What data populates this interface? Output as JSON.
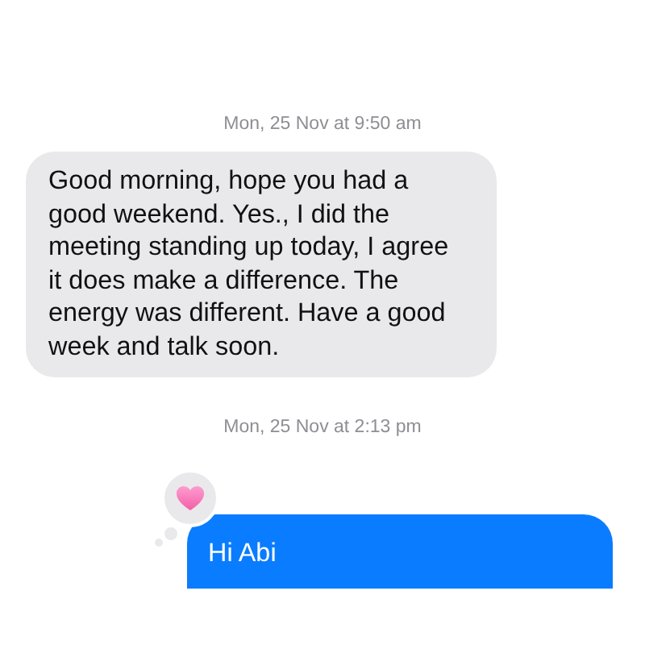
{
  "messages": [
    {
      "kind": "timestamp",
      "text": "Mon, 25 Nov at 9:50 am"
    },
    {
      "kind": "received",
      "text": "Good morning, hope you had a good weekend. Yes., I did the meeting standing up today, I agree it does make a difference. The energy was different. Have a good week and talk soon."
    },
    {
      "kind": "timestamp",
      "text": "Mon, 25 Nov at 2:13 pm"
    },
    {
      "kind": "sent",
      "text": "Hi Abi",
      "reaction": {
        "kind": "heart"
      }
    }
  ]
}
